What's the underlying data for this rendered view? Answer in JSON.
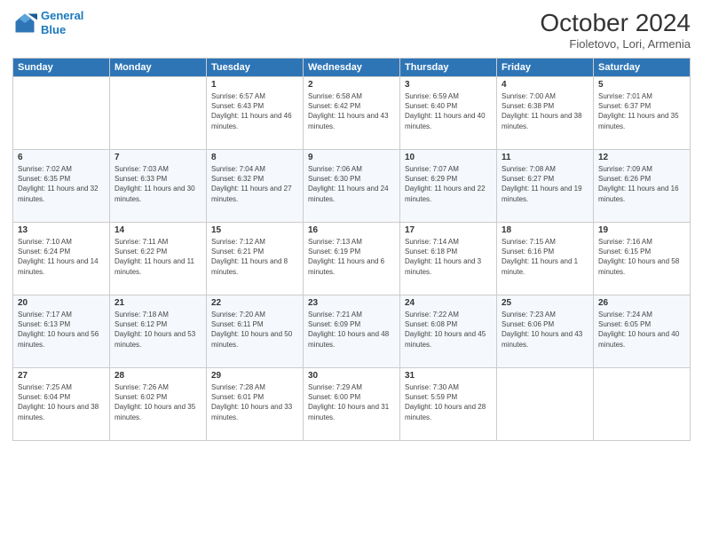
{
  "header": {
    "logo_line1": "General",
    "logo_line2": "Blue",
    "month_title": "October 2024",
    "location": "Fioletovo, Lori, Armenia"
  },
  "days_of_week": [
    "Sunday",
    "Monday",
    "Tuesday",
    "Wednesday",
    "Thursday",
    "Friday",
    "Saturday"
  ],
  "weeks": [
    [
      {
        "num": "",
        "sunrise": "",
        "sunset": "",
        "daylight": ""
      },
      {
        "num": "",
        "sunrise": "",
        "sunset": "",
        "daylight": ""
      },
      {
        "num": "1",
        "sunrise": "Sunrise: 6:57 AM",
        "sunset": "Sunset: 6:43 PM",
        "daylight": "Daylight: 11 hours and 46 minutes."
      },
      {
        "num": "2",
        "sunrise": "Sunrise: 6:58 AM",
        "sunset": "Sunset: 6:42 PM",
        "daylight": "Daylight: 11 hours and 43 minutes."
      },
      {
        "num": "3",
        "sunrise": "Sunrise: 6:59 AM",
        "sunset": "Sunset: 6:40 PM",
        "daylight": "Daylight: 11 hours and 40 minutes."
      },
      {
        "num": "4",
        "sunrise": "Sunrise: 7:00 AM",
        "sunset": "Sunset: 6:38 PM",
        "daylight": "Daylight: 11 hours and 38 minutes."
      },
      {
        "num": "5",
        "sunrise": "Sunrise: 7:01 AM",
        "sunset": "Sunset: 6:37 PM",
        "daylight": "Daylight: 11 hours and 35 minutes."
      }
    ],
    [
      {
        "num": "6",
        "sunrise": "Sunrise: 7:02 AM",
        "sunset": "Sunset: 6:35 PM",
        "daylight": "Daylight: 11 hours and 32 minutes."
      },
      {
        "num": "7",
        "sunrise": "Sunrise: 7:03 AM",
        "sunset": "Sunset: 6:33 PM",
        "daylight": "Daylight: 11 hours and 30 minutes."
      },
      {
        "num": "8",
        "sunrise": "Sunrise: 7:04 AM",
        "sunset": "Sunset: 6:32 PM",
        "daylight": "Daylight: 11 hours and 27 minutes."
      },
      {
        "num": "9",
        "sunrise": "Sunrise: 7:06 AM",
        "sunset": "Sunset: 6:30 PM",
        "daylight": "Daylight: 11 hours and 24 minutes."
      },
      {
        "num": "10",
        "sunrise": "Sunrise: 7:07 AM",
        "sunset": "Sunset: 6:29 PM",
        "daylight": "Daylight: 11 hours and 22 minutes."
      },
      {
        "num": "11",
        "sunrise": "Sunrise: 7:08 AM",
        "sunset": "Sunset: 6:27 PM",
        "daylight": "Daylight: 11 hours and 19 minutes."
      },
      {
        "num": "12",
        "sunrise": "Sunrise: 7:09 AM",
        "sunset": "Sunset: 6:26 PM",
        "daylight": "Daylight: 11 hours and 16 minutes."
      }
    ],
    [
      {
        "num": "13",
        "sunrise": "Sunrise: 7:10 AM",
        "sunset": "Sunset: 6:24 PM",
        "daylight": "Daylight: 11 hours and 14 minutes."
      },
      {
        "num": "14",
        "sunrise": "Sunrise: 7:11 AM",
        "sunset": "Sunset: 6:22 PM",
        "daylight": "Daylight: 11 hours and 11 minutes."
      },
      {
        "num": "15",
        "sunrise": "Sunrise: 7:12 AM",
        "sunset": "Sunset: 6:21 PM",
        "daylight": "Daylight: 11 hours and 8 minutes."
      },
      {
        "num": "16",
        "sunrise": "Sunrise: 7:13 AM",
        "sunset": "Sunset: 6:19 PM",
        "daylight": "Daylight: 11 hours and 6 minutes."
      },
      {
        "num": "17",
        "sunrise": "Sunrise: 7:14 AM",
        "sunset": "Sunset: 6:18 PM",
        "daylight": "Daylight: 11 hours and 3 minutes."
      },
      {
        "num": "18",
        "sunrise": "Sunrise: 7:15 AM",
        "sunset": "Sunset: 6:16 PM",
        "daylight": "Daylight: 11 hours and 1 minute."
      },
      {
        "num": "19",
        "sunrise": "Sunrise: 7:16 AM",
        "sunset": "Sunset: 6:15 PM",
        "daylight": "Daylight: 10 hours and 58 minutes."
      }
    ],
    [
      {
        "num": "20",
        "sunrise": "Sunrise: 7:17 AM",
        "sunset": "Sunset: 6:13 PM",
        "daylight": "Daylight: 10 hours and 56 minutes."
      },
      {
        "num": "21",
        "sunrise": "Sunrise: 7:18 AM",
        "sunset": "Sunset: 6:12 PM",
        "daylight": "Daylight: 10 hours and 53 minutes."
      },
      {
        "num": "22",
        "sunrise": "Sunrise: 7:20 AM",
        "sunset": "Sunset: 6:11 PM",
        "daylight": "Daylight: 10 hours and 50 minutes."
      },
      {
        "num": "23",
        "sunrise": "Sunrise: 7:21 AM",
        "sunset": "Sunset: 6:09 PM",
        "daylight": "Daylight: 10 hours and 48 minutes."
      },
      {
        "num": "24",
        "sunrise": "Sunrise: 7:22 AM",
        "sunset": "Sunset: 6:08 PM",
        "daylight": "Daylight: 10 hours and 45 minutes."
      },
      {
        "num": "25",
        "sunrise": "Sunrise: 7:23 AM",
        "sunset": "Sunset: 6:06 PM",
        "daylight": "Daylight: 10 hours and 43 minutes."
      },
      {
        "num": "26",
        "sunrise": "Sunrise: 7:24 AM",
        "sunset": "Sunset: 6:05 PM",
        "daylight": "Daylight: 10 hours and 40 minutes."
      }
    ],
    [
      {
        "num": "27",
        "sunrise": "Sunrise: 7:25 AM",
        "sunset": "Sunset: 6:04 PM",
        "daylight": "Daylight: 10 hours and 38 minutes."
      },
      {
        "num": "28",
        "sunrise": "Sunrise: 7:26 AM",
        "sunset": "Sunset: 6:02 PM",
        "daylight": "Daylight: 10 hours and 35 minutes."
      },
      {
        "num": "29",
        "sunrise": "Sunrise: 7:28 AM",
        "sunset": "Sunset: 6:01 PM",
        "daylight": "Daylight: 10 hours and 33 minutes."
      },
      {
        "num": "30",
        "sunrise": "Sunrise: 7:29 AM",
        "sunset": "Sunset: 6:00 PM",
        "daylight": "Daylight: 10 hours and 31 minutes."
      },
      {
        "num": "31",
        "sunrise": "Sunrise: 7:30 AM",
        "sunset": "Sunset: 5:59 PM",
        "daylight": "Daylight: 10 hours and 28 minutes."
      },
      {
        "num": "",
        "sunrise": "",
        "sunset": "",
        "daylight": ""
      },
      {
        "num": "",
        "sunrise": "",
        "sunset": "",
        "daylight": ""
      }
    ]
  ]
}
